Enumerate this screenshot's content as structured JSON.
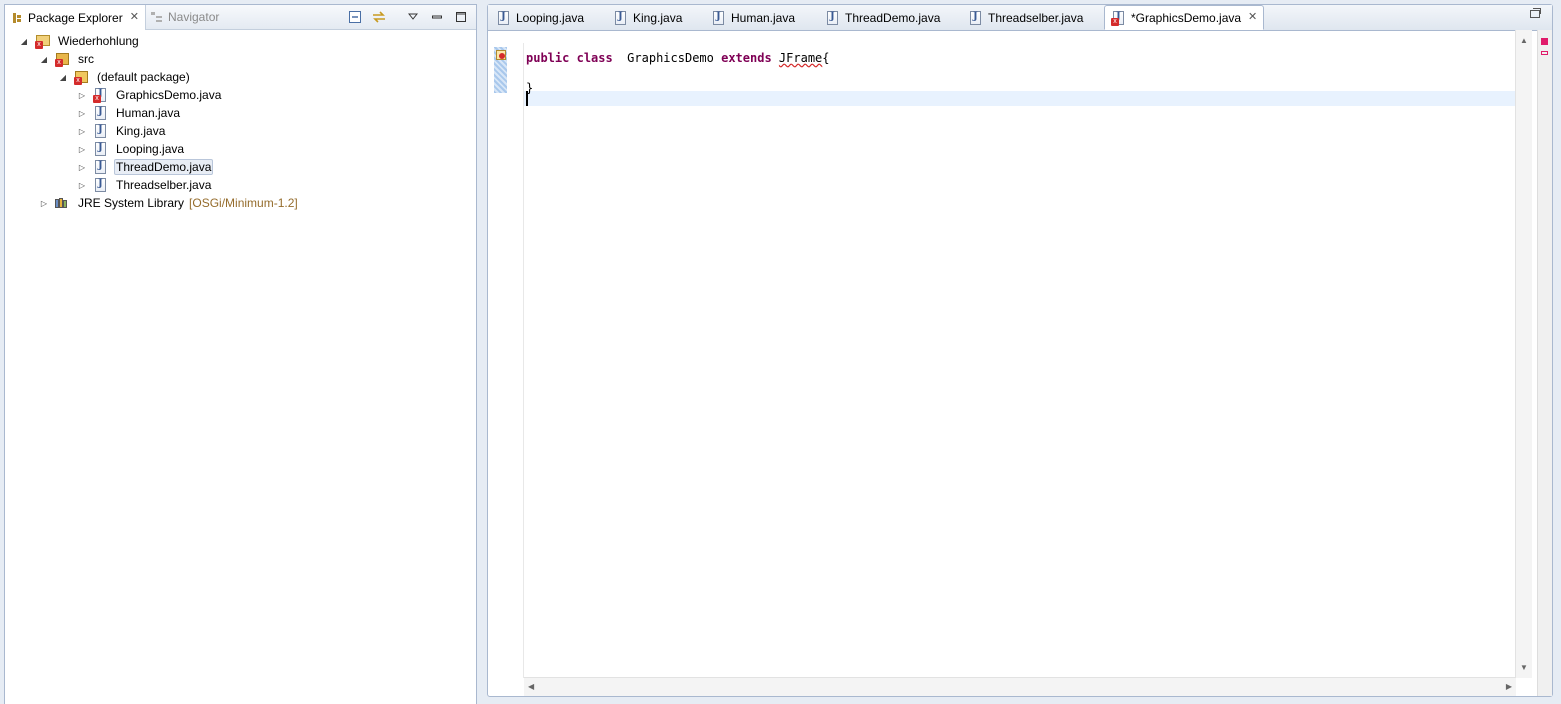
{
  "left_view": {
    "tabs": [
      {
        "label": "Package Explorer",
        "active": true
      },
      {
        "label": "Navigator",
        "active": false
      }
    ],
    "tree": {
      "project": "Wiederhohlung",
      "src": "src",
      "package": "(default package)",
      "files": [
        {
          "label": "GraphicsDemo.java",
          "error": true
        },
        {
          "label": "Human.java",
          "error": false
        },
        {
          "label": "King.java",
          "error": false
        },
        {
          "label": "Looping.java",
          "error": false
        },
        {
          "label": "ThreadDemo.java",
          "error": false,
          "selected": true
        },
        {
          "label": "Threadselber.java",
          "error": false
        }
      ],
      "library": {
        "label": "JRE System Library",
        "decoration": "[OSGi/Minimum-1.2]"
      }
    }
  },
  "editor": {
    "tabs": [
      {
        "label": "Looping.java"
      },
      {
        "label": "King.java"
      },
      {
        "label": "Human.java"
      },
      {
        "label": "ThreadDemo.java"
      },
      {
        "label": "Threadselber.java"
      },
      {
        "label": "*GraphicsDemo.java",
        "active": true
      }
    ],
    "code": {
      "line1": {
        "kw1": "public",
        "kw2": "class",
        "name": "GraphicsDemo",
        "kw3": "extends",
        "type": "JFrame",
        "brace": "{"
      },
      "line3": "}"
    }
  },
  "colors": {
    "keyword": "#7f0055",
    "error": "#d42b2b",
    "current_line": "#e8f2fe",
    "decoration": "#956c2c"
  }
}
